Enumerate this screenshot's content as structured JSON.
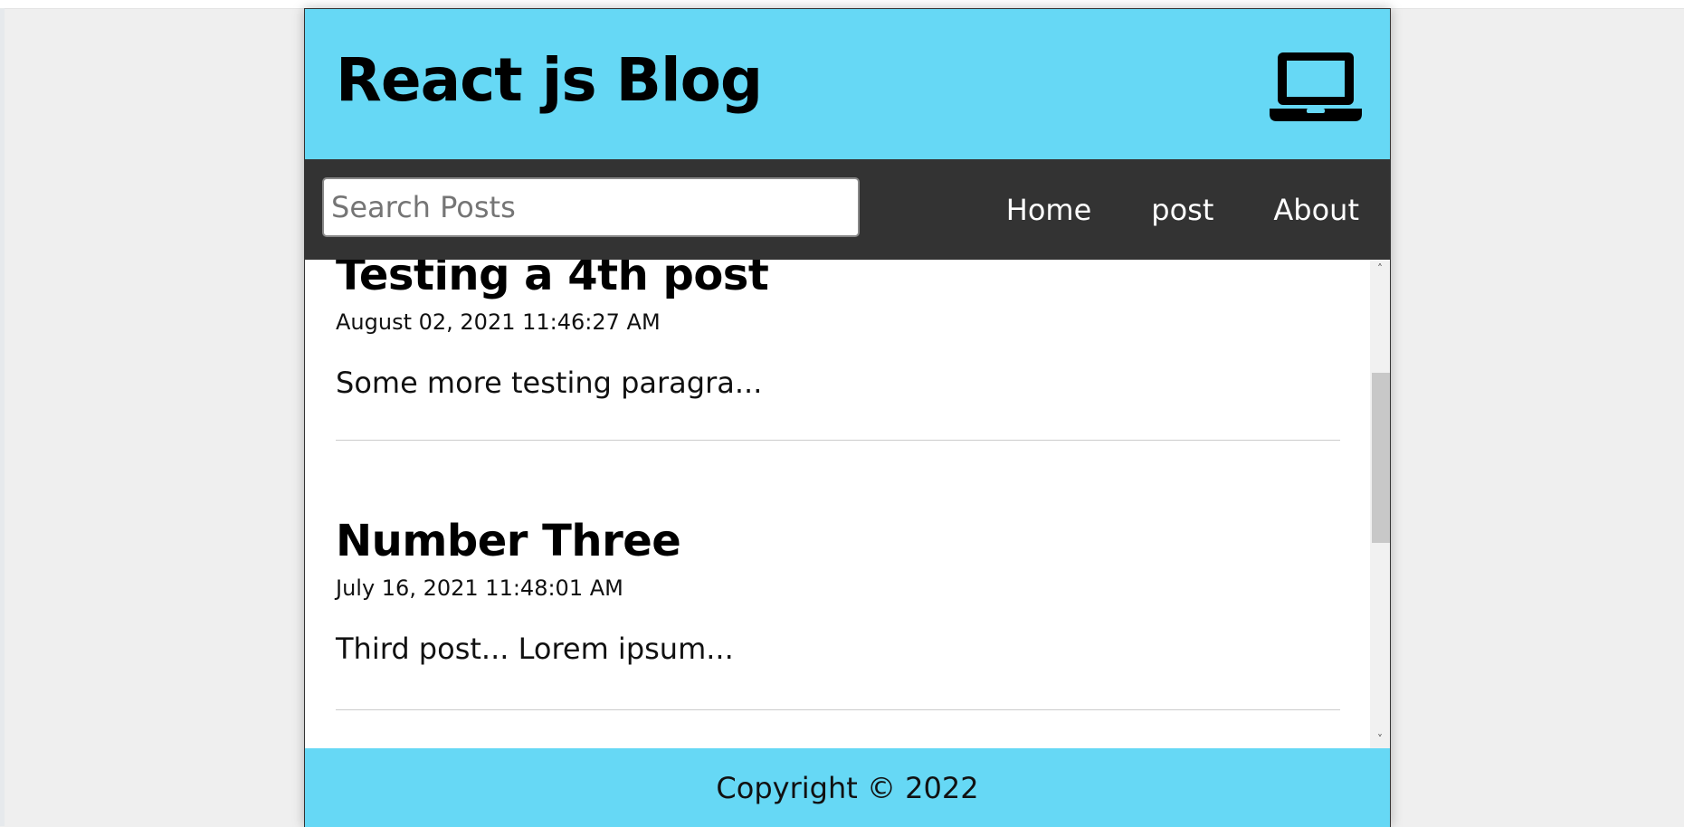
{
  "header": {
    "title": "React js Blog",
    "icon": "laptop-icon"
  },
  "nav": {
    "search_placeholder": "Search Posts",
    "search_value": "",
    "links": [
      {
        "label": "Home"
      },
      {
        "label": "post"
      },
      {
        "label": "About"
      }
    ]
  },
  "posts": [
    {
      "title": "Testing a 4th post",
      "date": "August 02, 2021 11:46:27 AM",
      "excerpt": "Some more testing paragra..."
    },
    {
      "title": "Number Three",
      "date": "July 16, 2021 11:48:01 AM",
      "excerpt": "Third post... Lorem ipsum..."
    }
  ],
  "footer": {
    "copyright": "Copyright © 2022"
  },
  "colors": {
    "header_bg": "#66d8f5",
    "nav_bg": "#333333",
    "footer_bg": "#66d8f5"
  }
}
